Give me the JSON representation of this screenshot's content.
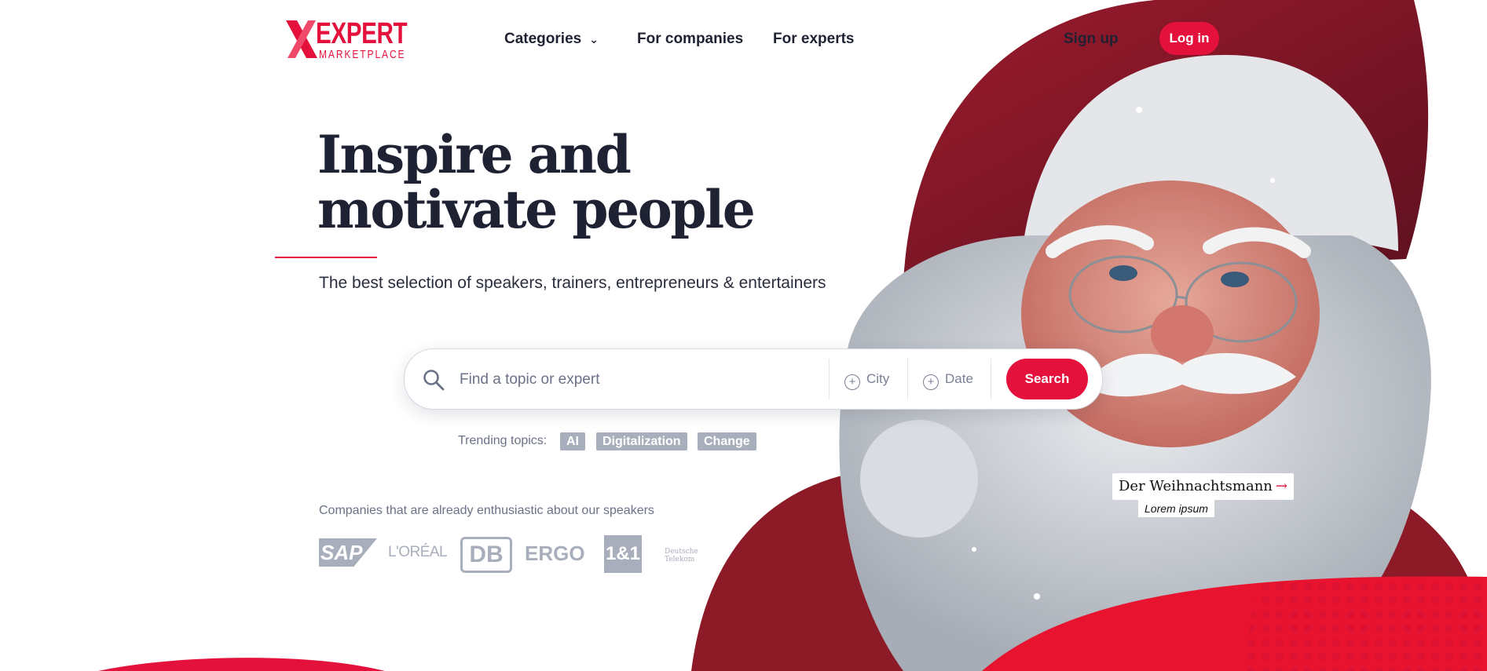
{
  "brand": {
    "name_line1": "EXPERT",
    "name_line2": "MARKETPLACE",
    "accent_color": "#e3113b"
  },
  "nav": {
    "items": [
      {
        "label": "Categories",
        "has_dropdown": true
      },
      {
        "label": "For companies"
      },
      {
        "label": "For experts"
      }
    ],
    "signup_label": "Sign up",
    "login_label": "Log in"
  },
  "hero": {
    "headline": "Inspire and motivate people",
    "subtitle": "The best selection of speakers, trainers, entrepreneurs & entertainers"
  },
  "search": {
    "placeholder": "Find a topic or expert",
    "value": "",
    "city_label": "City",
    "date_label": "Date",
    "button_label": "Search"
  },
  "trending": {
    "label": "Trending topics:",
    "tags": [
      "AI",
      "Digitalization",
      "Change"
    ]
  },
  "companies": {
    "label": "Companies that are already enthusiastic about our speakers",
    "logos": [
      "SAP",
      "L'ORÉAL",
      "DB",
      "ERGO",
      "1&1",
      "Deutsche Telekom"
    ]
  },
  "featured_expert": {
    "name": "Der Weihnachtsmann",
    "arrow": "→",
    "subtitle": "Lorem ipsum"
  }
}
